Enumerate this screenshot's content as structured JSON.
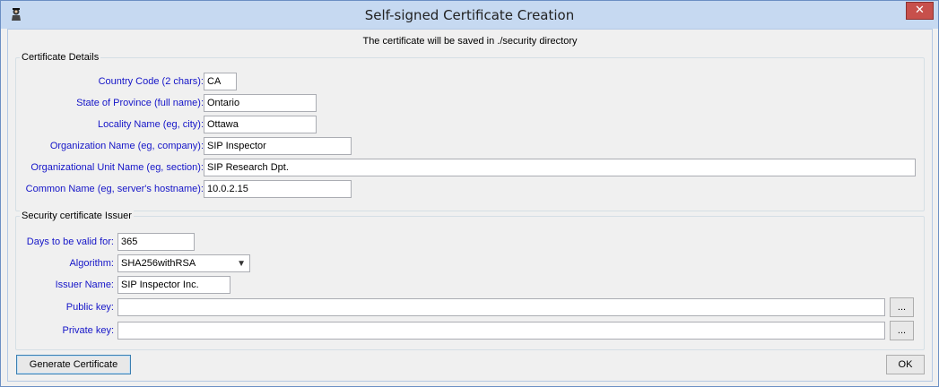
{
  "window": {
    "title": "Self-signed Certificate Creation",
    "close_glyph": "✕"
  },
  "notice": "The certificate will be saved in ./security directory",
  "details": {
    "legend": "Certificate Details",
    "country_label": "Country Code (2 chars):",
    "country_value": "CA",
    "state_label": "State of Province (full name):",
    "state_value": "Ontario",
    "locality_label": "Locality Name (eg, city):",
    "locality_value": "Ottawa",
    "org_label": "Organization Name (eg, company):",
    "org_value": "SIP Inspector",
    "orgunit_label": "Organizational Unit Name (eg, section):",
    "orgunit_value": "SIP Research Dpt.",
    "cn_label": "Common Name (eg, server's hostname):",
    "cn_value": "10.0.2.15"
  },
  "issuer": {
    "legend": "Security certificate Issuer",
    "days_label": "Days to be valid for:",
    "days_value": "365",
    "algorithm_label": "Algorithm:",
    "algorithm_value": "SHA256withRSA",
    "issuer_name_label": "Issuer Name:",
    "issuer_name_value": "SIP Inspector Inc.",
    "public_key_label": "Public key:",
    "public_key_value": "",
    "private_key_label": "Private key:",
    "private_key_value": "",
    "browse_label": "..."
  },
  "buttons": {
    "generate": "Generate Certificate",
    "ok": "OK"
  }
}
